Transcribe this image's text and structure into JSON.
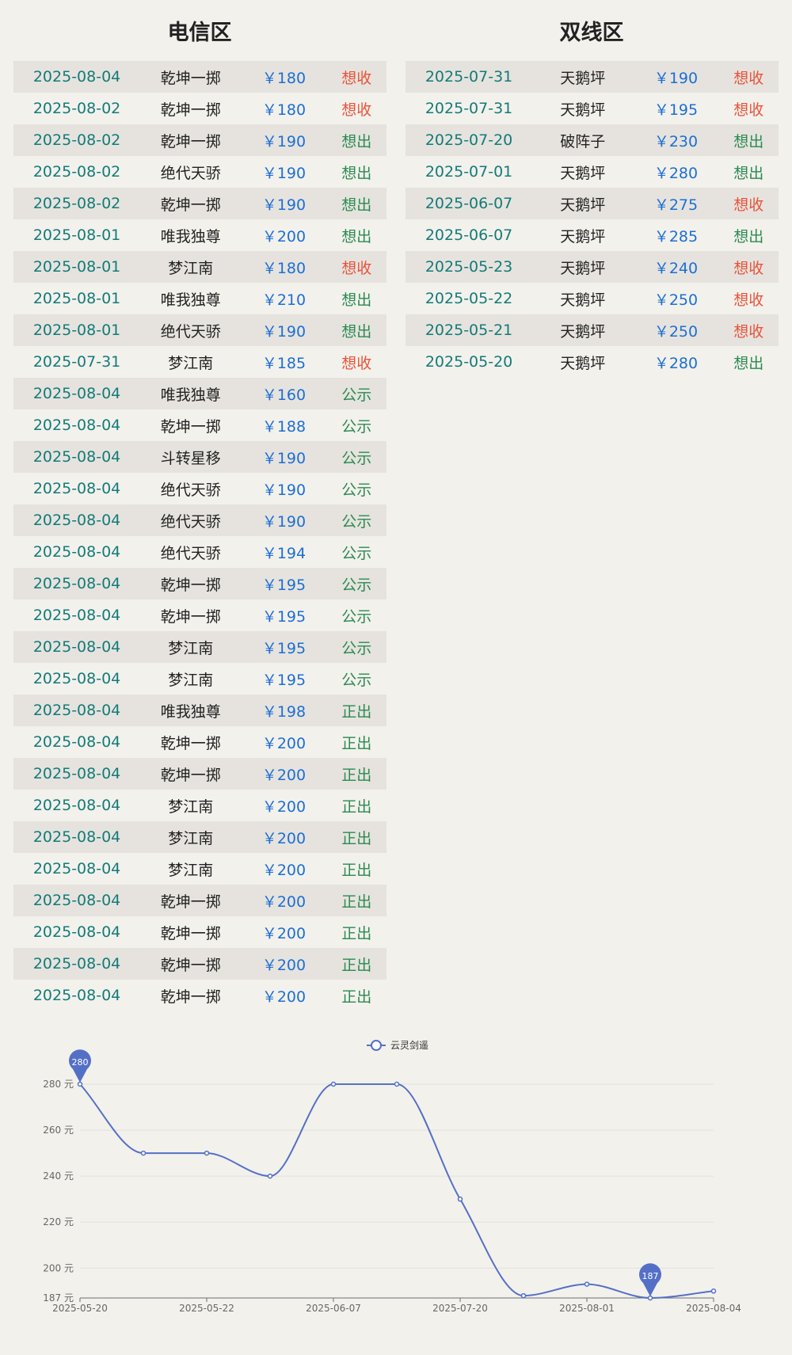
{
  "panels": [
    {
      "title": "电信区",
      "rows": [
        {
          "date": "2025-08-04",
          "server": "乾坤一掷",
          "price": "￥180",
          "action": "想收",
          "kind": "buy"
        },
        {
          "date": "2025-08-02",
          "server": "乾坤一掷",
          "price": "￥180",
          "action": "想收",
          "kind": "buy"
        },
        {
          "date": "2025-08-02",
          "server": "乾坤一掷",
          "price": "￥190",
          "action": "想出",
          "kind": "sell"
        },
        {
          "date": "2025-08-02",
          "server": "绝代天骄",
          "price": "￥190",
          "action": "想出",
          "kind": "sell"
        },
        {
          "date": "2025-08-02",
          "server": "乾坤一掷",
          "price": "￥190",
          "action": "想出",
          "kind": "sell"
        },
        {
          "date": "2025-08-01",
          "server": "唯我独尊",
          "price": "￥200",
          "action": "想出",
          "kind": "sell"
        },
        {
          "date": "2025-08-01",
          "server": "梦江南",
          "price": "￥180",
          "action": "想收",
          "kind": "buy"
        },
        {
          "date": "2025-08-01",
          "server": "唯我独尊",
          "price": "￥210",
          "action": "想出",
          "kind": "sell"
        },
        {
          "date": "2025-08-01",
          "server": "绝代天骄",
          "price": "￥190",
          "action": "想出",
          "kind": "sell"
        },
        {
          "date": "2025-07-31",
          "server": "梦江南",
          "price": "￥185",
          "action": "想收",
          "kind": "buy"
        },
        {
          "date": "2025-08-04",
          "server": "唯我独尊",
          "price": "￥160",
          "action": "公示",
          "kind": "pub"
        },
        {
          "date": "2025-08-04",
          "server": "乾坤一掷",
          "price": "￥188",
          "action": "公示",
          "kind": "pub"
        },
        {
          "date": "2025-08-04",
          "server": "斗转星移",
          "price": "￥190",
          "action": "公示",
          "kind": "pub"
        },
        {
          "date": "2025-08-04",
          "server": "绝代天骄",
          "price": "￥190",
          "action": "公示",
          "kind": "pub"
        },
        {
          "date": "2025-08-04",
          "server": "绝代天骄",
          "price": "￥190",
          "action": "公示",
          "kind": "pub"
        },
        {
          "date": "2025-08-04",
          "server": "绝代天骄",
          "price": "￥194",
          "action": "公示",
          "kind": "pub"
        },
        {
          "date": "2025-08-04",
          "server": "乾坤一掷",
          "price": "￥195",
          "action": "公示",
          "kind": "pub"
        },
        {
          "date": "2025-08-04",
          "server": "乾坤一掷",
          "price": "￥195",
          "action": "公示",
          "kind": "pub"
        },
        {
          "date": "2025-08-04",
          "server": "梦江南",
          "price": "￥195",
          "action": "公示",
          "kind": "pub"
        },
        {
          "date": "2025-08-04",
          "server": "梦江南",
          "price": "￥195",
          "action": "公示",
          "kind": "pub"
        },
        {
          "date": "2025-08-04",
          "server": "唯我独尊",
          "price": "￥198",
          "action": "正出",
          "kind": "ok"
        },
        {
          "date": "2025-08-04",
          "server": "乾坤一掷",
          "price": "￥200",
          "action": "正出",
          "kind": "ok"
        },
        {
          "date": "2025-08-04",
          "server": "乾坤一掷",
          "price": "￥200",
          "action": "正出",
          "kind": "ok"
        },
        {
          "date": "2025-08-04",
          "server": "梦江南",
          "price": "￥200",
          "action": "正出",
          "kind": "ok"
        },
        {
          "date": "2025-08-04",
          "server": "梦江南",
          "price": "￥200",
          "action": "正出",
          "kind": "ok"
        },
        {
          "date": "2025-08-04",
          "server": "梦江南",
          "price": "￥200",
          "action": "正出",
          "kind": "ok"
        },
        {
          "date": "2025-08-04",
          "server": "乾坤一掷",
          "price": "￥200",
          "action": "正出",
          "kind": "ok"
        },
        {
          "date": "2025-08-04",
          "server": "乾坤一掷",
          "price": "￥200",
          "action": "正出",
          "kind": "ok"
        },
        {
          "date": "2025-08-04",
          "server": "乾坤一掷",
          "price": "￥200",
          "action": "正出",
          "kind": "ok"
        },
        {
          "date": "2025-08-04",
          "server": "乾坤一掷",
          "price": "￥200",
          "action": "正出",
          "kind": "ok"
        }
      ]
    },
    {
      "title": "双线区",
      "rows": [
        {
          "date": "2025-07-31",
          "server": "天鹅坪",
          "price": "￥190",
          "action": "想收",
          "kind": "buy"
        },
        {
          "date": "2025-07-31",
          "server": "天鹅坪",
          "price": "￥195",
          "action": "想收",
          "kind": "buy"
        },
        {
          "date": "2025-07-20",
          "server": "破阵子",
          "price": "￥230",
          "action": "想出",
          "kind": "sell"
        },
        {
          "date": "2025-07-01",
          "server": "天鹅坪",
          "price": "￥280",
          "action": "想出",
          "kind": "sell"
        },
        {
          "date": "2025-06-07",
          "server": "天鹅坪",
          "price": "￥275",
          "action": "想收",
          "kind": "buy"
        },
        {
          "date": "2025-06-07",
          "server": "天鹅坪",
          "price": "￥285",
          "action": "想出",
          "kind": "sell"
        },
        {
          "date": "2025-05-23",
          "server": "天鹅坪",
          "price": "￥240",
          "action": "想收",
          "kind": "buy"
        },
        {
          "date": "2025-05-22",
          "server": "天鹅坪",
          "price": "￥250",
          "action": "想收",
          "kind": "buy"
        },
        {
          "date": "2025-05-21",
          "server": "天鹅坪",
          "price": "￥250",
          "action": "想收",
          "kind": "buy"
        },
        {
          "date": "2025-05-20",
          "server": "天鹅坪",
          "price": "￥280",
          "action": "想出",
          "kind": "sell"
        }
      ]
    }
  ],
  "colors": {
    "line": "#5470c6",
    "buy": "#e8533a",
    "sell": "#2a8a52",
    "date": "#137b78",
    "price": "#1c6fd4"
  },
  "chart_data": {
    "type": "line",
    "legend": "云灵剑遥",
    "legend_position": "top-center",
    "series": [
      {
        "name": "云灵剑遥",
        "values": [
          280,
          250,
          250,
          240,
          280,
          280,
          230,
          188,
          193,
          187,
          190
        ]
      }
    ],
    "x": [
      "2025-05-20",
      "2025-05-21",
      "2025-05-22",
      "2025-05-23",
      "2025-06-07",
      "2025-07-01",
      "2025-07-20",
      "2025-07-31",
      "2025-08-01",
      "2025-08-02",
      "2025-08-04"
    ],
    "x_tick_labels": [
      "2025-05-20",
      "2025-05-22",
      "2025-06-07",
      "2025-07-20",
      "2025-08-01",
      "2025-08-04"
    ],
    "y_ticks": [
      187,
      200,
      220,
      240,
      260,
      280
    ],
    "y_unit": "元",
    "ylim": [
      187,
      280
    ],
    "markers": [
      {
        "label": "280",
        "value": 280,
        "index": 0
      },
      {
        "label": "187",
        "value": 187,
        "index": 9
      }
    ],
    "grid": true,
    "smooth": true
  }
}
